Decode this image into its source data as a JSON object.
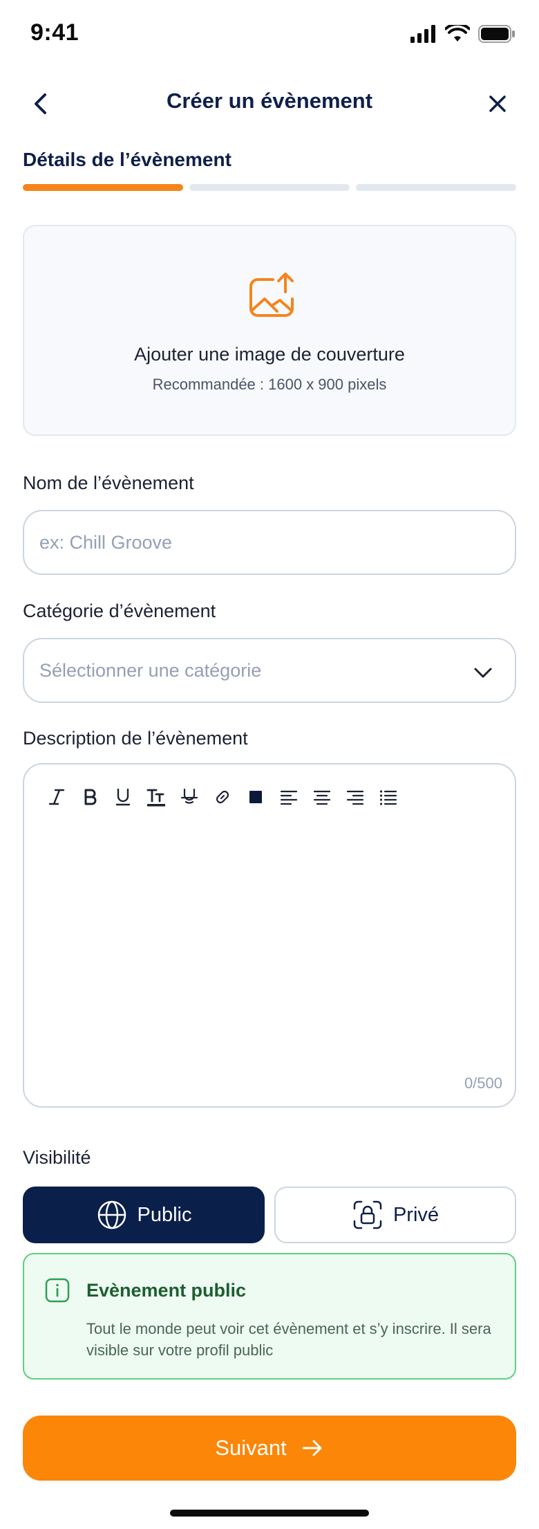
{
  "status": {
    "time": "9:41",
    "icons": [
      "cellular-signal-icon",
      "wifi-icon",
      "battery-icon"
    ]
  },
  "nav": {
    "title": "Créer un évènement",
    "back_icon": "chevron-left-icon",
    "close_icon": "close-icon"
  },
  "step": {
    "title": "Détails de l’évènement",
    "progress": {
      "current": 1,
      "total": 3
    }
  },
  "cover": {
    "icon": "image-upload-icon",
    "title": "Ajouter une image de couverture",
    "subtitle": "Recommandée : 1600 x 900 pixels"
  },
  "form": {
    "name": {
      "label": "Nom de l’évènement",
      "placeholder": "ex: Chill Groove",
      "value": ""
    },
    "category": {
      "label": "Catégorie d’évènement",
      "placeholder": "Sélectionner une catégorie",
      "icon": "chevron-down-icon"
    },
    "description": {
      "label": "Description de l’évènement",
      "counter": "0/500",
      "toolbar": [
        "italic-icon",
        "bold-icon",
        "underline-icon",
        "text-size-icon",
        "strikethrough-icon",
        "link-icon",
        "color-swatch-icon",
        "align-left-icon",
        "align-center-icon",
        "align-right-icon",
        "bullet-list-icon"
      ]
    }
  },
  "visibility": {
    "label": "Visibilité",
    "options": [
      {
        "label": "Public",
        "icon": "globe-icon",
        "selected": true
      },
      {
        "label": "Privé",
        "icon": "lock-icon",
        "selected": false
      }
    ],
    "info": {
      "icon": "info-icon",
      "title": "Evènement public",
      "text": "Tout le monde peut voir cet évènement et s’y inscrire. Il sera visible sur votre profil public"
    }
  },
  "actions": {
    "next_label": "Suivant",
    "next_icon": "arrow-right-icon"
  },
  "colors": {
    "accent": "#FB8608",
    "navy": "#0B1F4B",
    "success_bg": "#EDFBF2",
    "success_border": "#5FCF7F"
  }
}
